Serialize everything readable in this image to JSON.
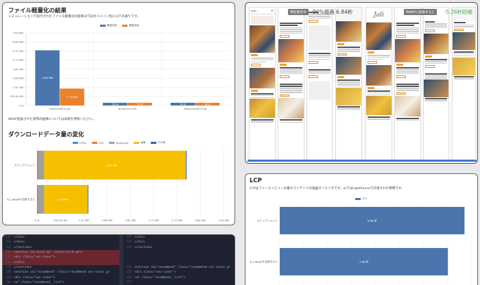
{
  "file_section": {
    "title": "ファイル軽量化の結果",
    "desc": "シミュレーションで実行されたファイル軽量化の結果は下記のドメイン別に以下の通りです。",
    "legend": [
      "軽量化前",
      "軽量化後"
    ],
    "note": "WebP変換された実際の画像については末尾を参照ください。"
  },
  "download_section": {
    "title": "ダウンロードデータ量の変化",
    "legend": [
      "HTML",
      "CSS",
      "JavaScript",
      "画像",
      "その他"
    ]
  },
  "screens": {
    "badge_left": "現在配信中",
    "time_left": "90%描画 6.84秒",
    "badge_right": "WebPに変換すると",
    "time_right": "-5.26秒短縮",
    "logo": "Jali",
    "headlines": [
      "Ideas",
      "This is post for the snow that love to travel",
      "How to paint the wall and street",
      "A new festival in your town",
      "How to make your home modern",
      "One more night in the local"
    ]
  },
  "lcp_section": {
    "title": "LCP",
    "desc": "LCPはファーストビューの最大コンテンツの描画タイミングです。以下はLighthouseで計測された時間です。",
    "legend": "LCP"
  },
  "code": {
    "left": [
      {
        "n": "221",
        "t": "        </div>"
      },
      {
        "n": "222",
        "t": "      </div>"
      },
      {
        "n": "223",
        "t": "    </section>"
      },
      {
        "n": "224",
        "t": "    <section id=\"pick-up\" class=\"pick-up\">",
        "hl": true
      },
      {
        "n": "225",
        "t": "      <div class=\"sec-inner\">",
        "hl": true
      },
      {
        "n": "226",
        "t": "      </div>",
        "hl": true
      },
      {
        "n": "227",
        "t": "    </section>"
      },
      {
        "n": "228",
        "t": "    <section id=\"recommend\" class=\"recommend sec-color_gr"
      },
      {
        "n": "229",
        "t": "      <div class=\"sec-inner\">"
      },
      {
        "n": "230",
        "t": "        <ul class=\"recommend__list\">"
      }
    ],
    "right": [
      {
        "n": "221",
        "t": "        </div>"
      },
      {
        "n": "222",
        "t": "      </div>"
      },
      {
        "n": "223",
        "t": "    </section>"
      },
      {
        "n": "",
        "t": ""
      },
      {
        "n": "",
        "t": ""
      },
      {
        "n": "",
        "t": ""
      },
      {
        "n": "224",
        "t": "    <section id=\"recommend\" class=\"recommend sec-color_gr"
      },
      {
        "n": "225",
        "t": "      <div class=\"sec-inner\">"
      },
      {
        "n": "226",
        "t": "        <ul class=\"recommend__list\">"
      },
      {
        "n": "227",
        "t": ""
      }
    ]
  },
  "chart_data": [
    {
      "type": "bar",
      "title": "",
      "categories": [
        "www.jewel.co.jp",
        "bj.doukin.com",
        "www.google.co.jp"
      ],
      "series": [
        {
          "name": "軽量化前",
          "values": [
            5.8,
            0.05,
            0.05
          ],
          "labels": [
            "5.80 MB",
            "50 B",
            "50 B"
          ]
        },
        {
          "name": "軽量化後",
          "values": [
            1.78,
            0.05,
            0.05
          ],
          "labels": [
            "1.78 MB",
            "50 B",
            "50 B"
          ]
        }
      ],
      "yticks": [
        "0 B",
        "976.56 KB",
        "1.91 MB",
        "2.86 MB",
        "3.81 MB",
        "4.77 MB",
        "5.72 MB",
        "6.68 MB",
        "7.63 MB"
      ],
      "ylim": [
        0,
        7.63
      ],
      "colors": [
        "#4a76ad",
        "#e8822d"
      ]
    },
    {
      "type": "bar",
      "orientation": "horizontal",
      "stacked": true,
      "categories": [
        "スナップショット",
        "もしWebPを活用すると"
      ],
      "series": [
        {
          "name": "HTML",
          "values": [
            0.02,
            0.02
          ]
        },
        {
          "name": "CSS",
          "values": [
            0.02,
            0.02
          ]
        },
        {
          "name": "JavaScript",
          "values": [
            0.25,
            0.25
          ]
        },
        {
          "name": "画像",
          "values": [
            5.8,
            1.78
          ]
        },
        {
          "name": "その他",
          "values": [
            0.02,
            0.02
          ]
        }
      ],
      "bar_labels": [
        "5.80 MB",
        "1.78 MB"
      ],
      "xticks": [
        "0 B",
        "976.56 KB",
        "1.91 MB",
        "2.86 MB",
        "3.81 MB",
        "4.77 MB",
        "5.72 MB",
        "6.68 MB",
        "7.63 MB"
      ],
      "xlim": [
        0,
        7.63
      ],
      "colors": [
        "#4a8fd0",
        "#e8822d",
        "#a0a0a0",
        "#f5c000",
        "#3060b0"
      ]
    },
    {
      "type": "bar",
      "orientation": "horizontal",
      "categories": [
        "スナップショット",
        "もしWebPを活用すると"
      ],
      "series": [
        {
          "name": "LCP",
          "values": [
            8.66,
            7.88
          ]
        }
      ],
      "bar_labels": [
        "8.66 秒",
        "7.88 秒"
      ],
      "xlim": [
        0,
        9
      ],
      "colors": [
        "#4a76ad"
      ]
    }
  ]
}
